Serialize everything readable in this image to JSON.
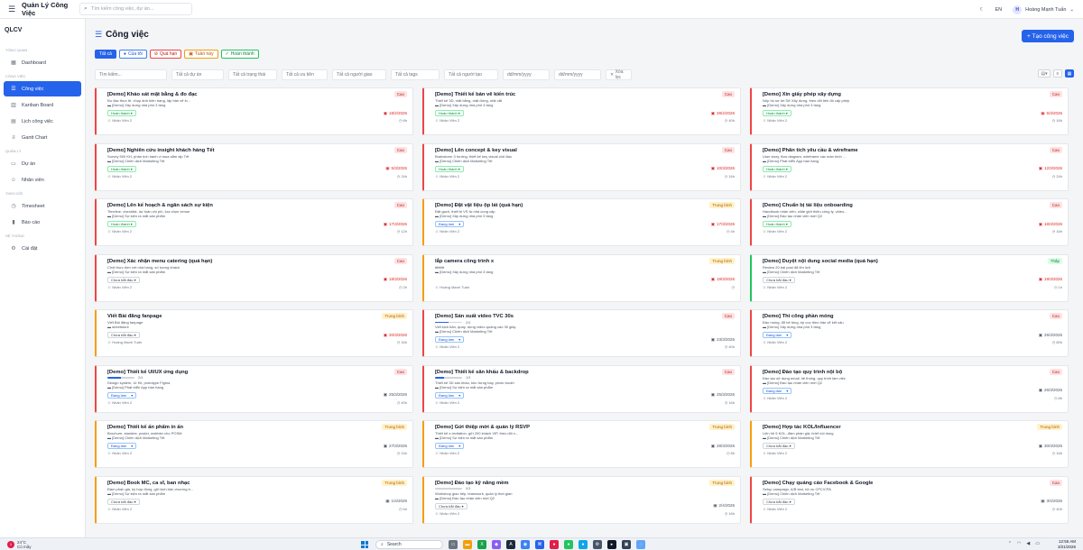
{
  "topbar": {
    "brand": "Quản Lý Công Việc",
    "search_placeholder": "Tìm kiếm công việc, dự án...",
    "lang": "EN",
    "avatar_initial": "H",
    "user_name": "Hoàng Mạnh Tuấn"
  },
  "sidebar": {
    "app_name": "QLCV",
    "sections": {
      "overview": "TỔNG QUAN",
      "work": "CÔNG VIỆC",
      "manage": "QUẢN LÝ",
      "track": "THEO DÕI",
      "system": "HỆ THỐNG"
    },
    "items": {
      "dashboard": "Dashboard",
      "tasks": "Công việc",
      "kanban": "Kanban Board",
      "calendar": "Lịch công việc",
      "gantt": "Gantt Chart",
      "projects": "Dự án",
      "staff": "Nhân viên",
      "timesheet": "Timesheet",
      "reports": "Báo cáo",
      "settings": "Cài đặt"
    }
  },
  "page": {
    "title": "Công việc",
    "new_button": "+ Tạo công việc",
    "filters": [
      "Tất cả",
      "Của tôi",
      "Quá hạn",
      "Tuần này",
      "Hoàn thành"
    ],
    "search": {
      "placeholder": "Tìm kiếm...",
      "project": "Tất cả dự án",
      "status": "Tất cả trạng thái",
      "priority": "Tất cả ưu tiên",
      "assignee": "Tất cả người giao",
      "tags": "Tất cả tags",
      "creator": "Tất cả người tạo",
      "date_from": "dd/mm/yyyy",
      "date_to": "dd/mm/yyyy",
      "clear": "Xóa lọc"
    }
  },
  "cards": [
    {
      "title": "[Demo] Khảo sát mặt bằng & đo đạc",
      "priority": "Cao",
      "level": "high",
      "desc": "Đo đạc thực tế, chụp ảnh hiện trạng, lập bản vẽ ki...",
      "project": "[Demo] Xây dựng nhà phố 3 tầng",
      "status": "Hoàn thành",
      "stype": "done",
      "date": "18/2/2026",
      "overdue": true,
      "assignee": "Nhân Viên 2",
      "hours": "8h",
      "progress": "",
      "pfill": 0
    },
    {
      "title": "[Demo] Thiết kế bản vẽ kiến trúc",
      "priority": "Cao",
      "level": "high",
      "desc": "Thiết kế 3D, mặt bằng, mặt đứng, mặt cắt",
      "project": "[Demo] Xây dựng nhà phố 3 tầng",
      "status": "Hoàn thành",
      "stype": "done",
      "date": "28/2/2026",
      "overdue": true,
      "assignee": "Nhân Viên 2",
      "hours": "40h",
      "progress": "",
      "pfill": 0
    },
    {
      "title": "[Demo] Xin giấy phép xây dựng",
      "priority": "Cao",
      "level": "high",
      "desc": "Nộp hồ sơ tới Sở Xây dựng, theo dõi tiến độ cấp phép",
      "project": "[Demo] Xây dựng nhà phố 3 tầng",
      "status": "Hoàn thành",
      "stype": "done",
      "date": "5/3/2026",
      "overdue": true,
      "assignee": "Nhân Viên 2",
      "hours": "16h",
      "progress": "",
      "pfill": 0
    },
    {
      "title": "[Demo] Nghiên cứu insight khách hàng Tết",
      "priority": "Cao",
      "level": "high",
      "desc": "Survey 500 KH, phân tích hành vi mua sắm dịp Tết",
      "project": "[Demo] Chiến dịch Marketing Tết",
      "status": "Hoàn thành",
      "stype": "done",
      "date": "5/3/2026",
      "overdue": true,
      "assignee": "Nhân Viên 2",
      "hours": "24h",
      "progress": "",
      "pfill": 0
    },
    {
      "title": "[Demo] Lên concept & key visual",
      "priority": "Cao",
      "level": "high",
      "desc": "Brainstorm 3 hướng, thiết kế key visual chủ đạo",
      "project": "[Demo] Chiến dịch Marketing Tết",
      "status": "Hoàn thành",
      "stype": "done",
      "date": "10/3/2026",
      "overdue": true,
      "assignee": "Nhân Viên 2",
      "hours": "16h",
      "progress": "",
      "pfill": 0
    },
    {
      "title": "[Demo] Phân tích yêu cầu & wireframe",
      "priority": "Cao",
      "level": "high",
      "desc": "User story, flow diagram, wireframe các màn hình ...",
      "project": "[Demo] Phát triển App bán hàng",
      "status": "Hoàn thành",
      "stype": "done",
      "date": "12/3/2026",
      "overdue": true,
      "assignee": "Nhân Viên 2",
      "hours": "24h",
      "progress": "",
      "pfill": 0
    },
    {
      "title": "[Demo] Lên kế hoạch & ngân sách sự kiện",
      "priority": "Cao",
      "level": "high",
      "desc": "Timeline, checklist, dự toán chi phí, lựa chọn venue",
      "project": "[Demo] Sự kiện ra mắt sản phẩm",
      "status": "Hoàn thành",
      "stype": "done",
      "date": "17/3/2026",
      "overdue": true,
      "assignee": "Nhân Viên 2",
      "hours": "12h",
      "progress": "",
      "pfill": 0
    },
    {
      "title": "[Demo] Đặt vật liệu ộp lát (quá hạn)",
      "priority": "Trung bình",
      "level": "med",
      "desc": "Đặt gạch, thiết bị VS từ nhà cung cấp",
      "project": "[Demo] Xây dựng nhà phố 3 tầng",
      "status": "Đang làm",
      "stype": "prog",
      "date": "17/3/2026",
      "overdue": true,
      "assignee": "Nhân Viên 2",
      "hours": "4h",
      "progress": "",
      "pfill": 0
    },
    {
      "title": "[Demo] Chuẩn bị tài liệu onboarding",
      "priority": "Cao",
      "level": "high",
      "desc": "Handbook nhân viên, slide giới thiệu công ty, video...",
      "project": "[Demo] Đào tạo nhân viên mới Q2",
      "status": "Hoàn thành",
      "stype": "done",
      "date": "18/3/2026",
      "overdue": true,
      "assignee": "Nhân Viên 2",
      "hours": "16h",
      "progress": "",
      "pfill": 0
    },
    {
      "title": "[Demo] Xác nhận menu catering (quá hạn)",
      "priority": "Cao",
      "level": "high",
      "desc": "Chốt thực đơn với nhà hàng, số lượng khách",
      "project": "[Demo] Sự kiện ra mắt sản phẩm",
      "status": "Chưa bắt đầu",
      "stype": "todo",
      "date": "18/3/2026",
      "overdue": true,
      "assignee": "Nhân Viên 2",
      "hours": "2h",
      "progress": "",
      "pfill": 0
    },
    {
      "title": "lắp camera công trình x",
      "priority": "Trung bình",
      "level": "med",
      "desc": "ttttttttt",
      "project": "[Demo] Xây dựng nhà phố 3 tầng",
      "status": "",
      "stype": "",
      "date": "19/3/2026",
      "overdue": true,
      "assignee": "Hoàng Mạnh Tuấn",
      "hours": "",
      "progress": "",
      "pfill": 0
    },
    {
      "title": "[Demo] Duyệt nội dung social media (quá hạn)",
      "priority": "Thấp",
      "level": "low",
      "desc": "Review 20 bài post đã lên lịch",
      "project": "[Demo] Chiến dịch Marketing Tết",
      "status": "Chưa bắt đầu",
      "stype": "todo",
      "date": "19/3/2026",
      "overdue": true,
      "assignee": "Nhân Viên 2",
      "hours": "1h",
      "progress": "",
      "pfill": 0
    },
    {
      "title": "Viết Bài đăng fanpage",
      "priority": "Trung bình",
      "level": "med",
      "desc": "Viết Bài đăng fanpage",
      "project": "sheetstore",
      "status": "Chưa bắt đầu",
      "stype": "todo",
      "date": "20/3/2026",
      "overdue": true,
      "assignee": "Hoàng Mạnh Tuấn",
      "hours": "16h",
      "progress": "",
      "pfill": 0
    },
    {
      "title": "[Demo] Sản xuất video TVC 30s",
      "priority": "Cao",
      "level": "high",
      "desc": "Viết kịch bản, quay, dựng video quảng cáo 30 giây",
      "project": "[Demo] Chiến dịch Marketing Tết",
      "status": "Đang làm",
      "stype": "prog",
      "date": "23/3/2026",
      "overdue": false,
      "assignee": "Nhân Viên 2",
      "hours": "40h",
      "progress": "2/4",
      "pfill": 50
    },
    {
      "title": "[Demo] Thi công phần móng",
      "priority": "Cao",
      "level": "high",
      "desc": "Đào móng, đổ bê tông, ép cọc theo bản vẽ kết cấu",
      "project": "[Demo] Xây dựng nhà phố 3 tầng",
      "status": "Đang làm",
      "stype": "prog",
      "date": "25/3/2026",
      "overdue": false,
      "assignee": "Nhân Viên 2",
      "hours": "80h",
      "progress": "",
      "pfill": 0
    },
    {
      "title": "[Demo] Thiết kế UI/UX ứng dụng",
      "priority": "Cao",
      "level": "high",
      "desc": "Design system, UI Kit, prototype Figma",
      "project": "[Demo] Phát triển App bán hàng",
      "status": "Đang làm",
      "stype": "prog",
      "date": "25/3/2026",
      "overdue": false,
      "assignee": "Nhân Viên 2",
      "hours": "40h",
      "progress": "2/4",
      "pfill": 50
    },
    {
      "title": "[Demo] Thiết kế sân khấu & backdrop",
      "priority": "Cao",
      "level": "high",
      "desc": "Thiết kế 3D sân khấu, khu trưng bày, photo booth",
      "project": "[Demo] Sự kiện ra mắt sản phẩm",
      "status": "Đang làm",
      "stype": "prog",
      "date": "25/3/2026",
      "overdue": false,
      "assignee": "Nhân Viên 2",
      "hours": "16h",
      "progress": "1/3",
      "pfill": 33
    },
    {
      "title": "[Demo] Đào tạo quy trình nội bộ",
      "priority": "Cao",
      "level": "high",
      "desc": "Đào tạo sử dụng email, hệ thống, quy trình làm việc",
      "project": "[Demo] Đào tạo nhân viên mới Q2",
      "status": "Đang làm",
      "stype": "prog",
      "date": "26/3/2026",
      "overdue": false,
      "assignee": "Nhân Viên 2",
      "hours": "8h",
      "progress": "",
      "pfill": 0
    },
    {
      "title": "[Demo] Thiết kế ấn phẩm in ấn",
      "priority": "Trung bình",
      "level": "med",
      "desc": "Brochure, standee, poster, wobbler cho POSM",
      "project": "[Demo] Chiến dịch Marketing Tết",
      "status": "Đang làm",
      "stype": "prog",
      "date": "27/3/2026",
      "overdue": false,
      "assignee": "Nhân Viên 2",
      "hours": "24h",
      "progress": "",
      "pfill": 0
    },
    {
      "title": "[Demo] Gửi thiệp mời & quản lý RSVP",
      "priority": "Trung bình",
      "level": "med",
      "desc": "Thiết kế e-invitation, gửi 200 khách VIP, theo dõi x...",
      "project": "[Demo] Sự kiện ra mắt sản phẩm",
      "status": "Đang làm",
      "stype": "prog",
      "date": "28/3/2026",
      "overdue": false,
      "assignee": "Nhân Viên 2",
      "hours": "8h",
      "progress": "",
      "pfill": 0
    },
    {
      "title": "[Demo] Hợp tác KOL/Influencer",
      "priority": "Trung bình",
      "level": "med",
      "desc": "Liên hệ 5 KOL, đàm phán giá, brief nội dung",
      "project": "[Demo] Chiến dịch Marketing Tết",
      "status": "Chưa bắt đầu",
      "stype": "todo",
      "date": "30/3/2026",
      "overdue": false,
      "assignee": "Nhân Viên 2",
      "hours": "16h",
      "progress": "",
      "pfill": 0
    },
    {
      "title": "[Demo] Book MC, ca sĩ, ban nhạc",
      "priority": "Trung bình",
      "level": "med",
      "desc": "Đàm phán giá, ký hợp đồng, gửi kịch bản chương tr...",
      "project": "[Demo] Sự kiện ra mắt sản phẩm",
      "status": "Chưa bắt đầu",
      "stype": "todo",
      "date": "1/4/2026",
      "overdue": false,
      "assignee": "Nhân Viên 2",
      "hours": "6h",
      "progress": "",
      "pfill": 0
    },
    {
      "title": "[Demo] Đào tạo kỹ năng mềm",
      "priority": "Trung bình",
      "level": "med",
      "desc": "Workshop giao tiếp, teamwork, quản lý thời gian",
      "project": "[Demo] Đào tạo nhân viên mới Q2",
      "status": "Chưa bắt đầu",
      "stype": "todo",
      "date": "2/4/2026",
      "overdue": false,
      "assignee": "Nhân Viên 2",
      "hours": "16h",
      "progress": "0/3",
      "pfill": 0
    },
    {
      "title": "[Demo] Chạy quảng cáo Facebook & Google",
      "priority": "Cao",
      "level": "high",
      "desc": "Setup campaign, A/B test, tối ưu CPC/CPA",
      "project": "[Demo] Chiến dịch Marketing Tết",
      "status": "Chưa bắt đầu",
      "stype": "todo",
      "date": "3/4/2026",
      "overdue": false,
      "assignee": "Nhân Viên 2",
      "hours": "40h",
      "progress": "",
      "pfill": 0
    }
  ],
  "taskbar": {
    "weather_badge": "1",
    "temp": "24°C",
    "condition": "Có mây",
    "search": "Search",
    "time": "12:55 AM",
    "date": "3/21/2026"
  }
}
